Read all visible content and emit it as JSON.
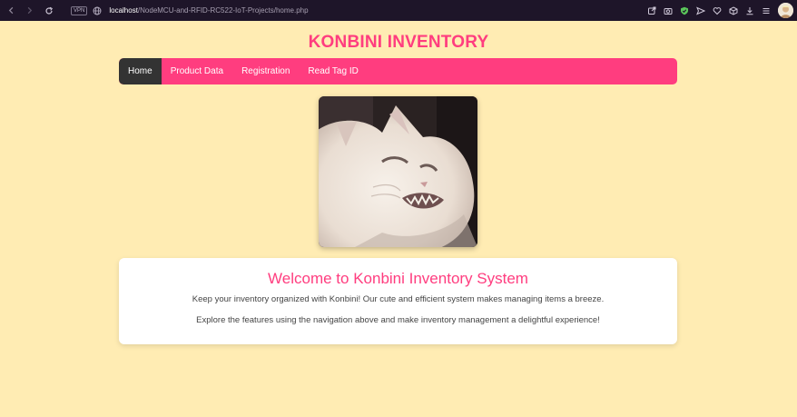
{
  "browser": {
    "vpn_label": "VPN",
    "url_host": "localhost",
    "url_path": "/NodeMCU-and-RFID-RC522-IoT-Projects/home.php"
  },
  "site": {
    "title": "KONBINI INVENTORY",
    "accent_color": "#ff3d7f",
    "background_color": "#ffecb3"
  },
  "nav": {
    "items": [
      {
        "label": "Home",
        "active": true
      },
      {
        "label": "Product Data",
        "active": false
      },
      {
        "label": "Registration",
        "active": false
      },
      {
        "label": "Read Tag ID",
        "active": false
      }
    ]
  },
  "welcome": {
    "heading": "Welcome to Konbini Inventory System",
    "paragraph_1": "Keep your inventory organized with Konbini! Our cute and efficient system makes managing items a breeze.",
    "paragraph_2": "Explore the features using the navigation above and make inventory management a delightful experience!"
  },
  "icons": {
    "back": "chevron-left-icon",
    "forward": "chevron-right-icon",
    "reload": "reload-icon",
    "globe": "globe-icon",
    "extensions": [
      "share-icon",
      "camera-icon",
      "shield-icon",
      "send-icon",
      "heart-icon",
      "cube-icon",
      "download-icon",
      "menu-icon"
    ]
  }
}
